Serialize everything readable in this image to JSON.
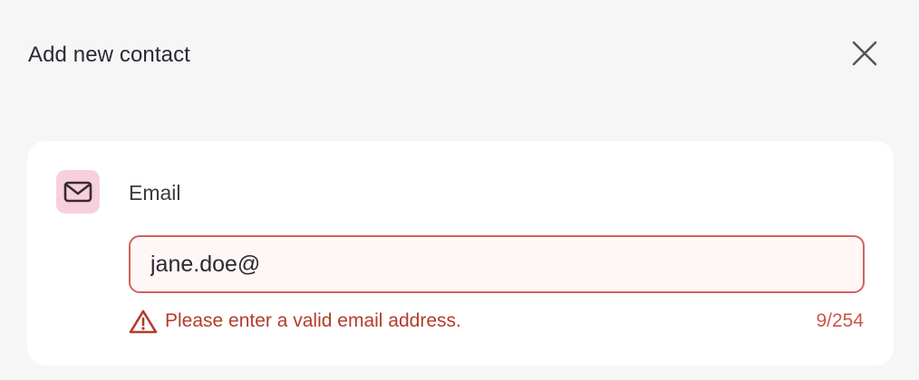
{
  "dialog": {
    "title": "Add new contact",
    "close_icon": "close-icon"
  },
  "field": {
    "icon": "mail-icon",
    "icon_bg": "#f8d0dc",
    "label": "Email",
    "value": "jane.doe@",
    "error_message": "Please enter a valid email address.",
    "error_icon": "warning-icon",
    "counter": "9/254",
    "error_color": "#b43b2b",
    "border_color": "#d3625a"
  }
}
